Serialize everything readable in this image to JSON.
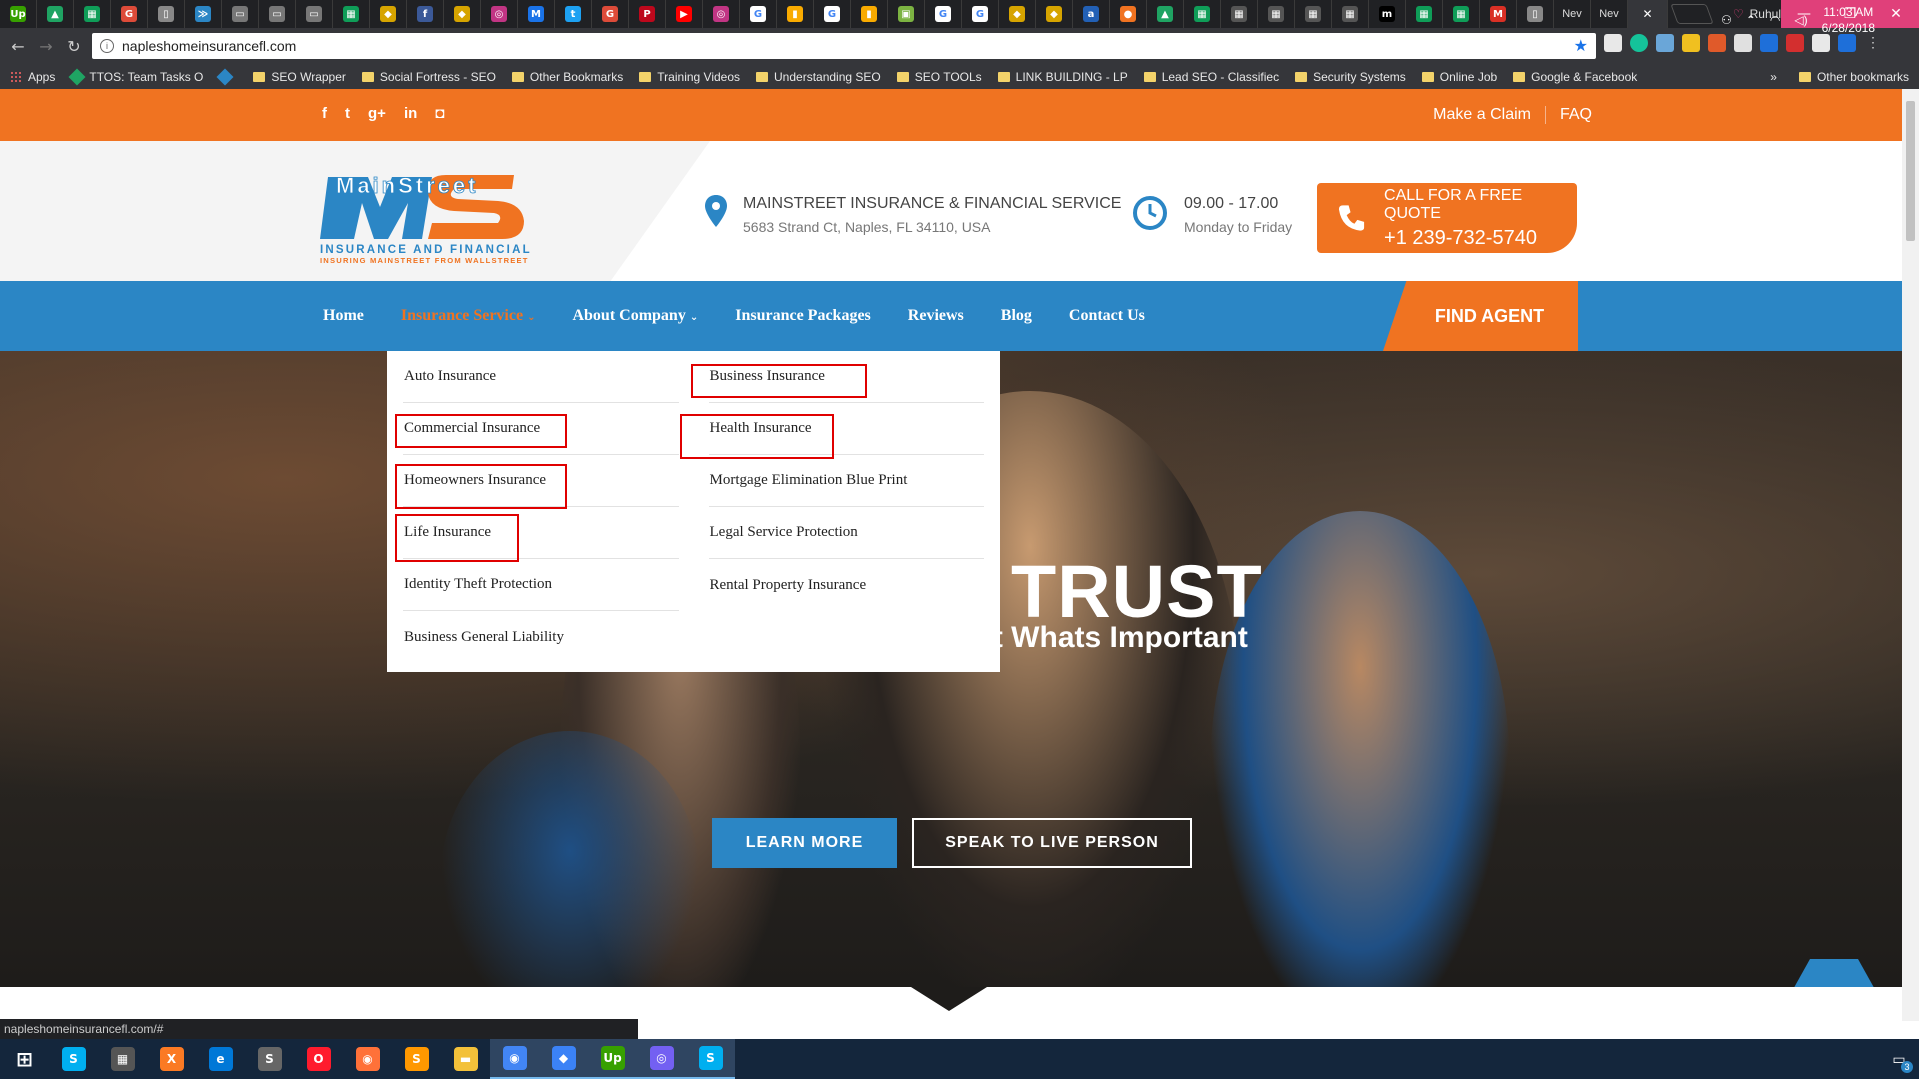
{
  "browser": {
    "tabs": [
      {
        "icon": "upwork-icon",
        "color": "#37a000",
        "glyph": "Up"
      },
      {
        "icon": "google-drive-icon",
        "color": "#1fa463",
        "glyph": "▲"
      },
      {
        "icon": "google-sheets-icon",
        "color": "#0f9d58",
        "glyph": "▦"
      },
      {
        "icon": "google-plus-icon",
        "color": "#dd4b39",
        "glyph": "G"
      },
      {
        "icon": "document-icon",
        "color": "#888888",
        "glyph": "▯"
      },
      {
        "icon": "hostgator-icon",
        "color": "#2b86c5",
        "glyph": "≫"
      },
      {
        "icon": "car-icon",
        "color": "#777777",
        "glyph": "▭"
      },
      {
        "icon": "car-icon",
        "color": "#777777",
        "glyph": "▭"
      },
      {
        "icon": "car-icon",
        "color": "#777777",
        "glyph": "▭"
      },
      {
        "icon": "google-sheets-icon",
        "color": "#0f9d58",
        "glyph": "▦"
      },
      {
        "icon": "shield-icon",
        "color": "#d6a400",
        "glyph": "◆"
      },
      {
        "icon": "facebook-icon",
        "color": "#3b5998",
        "glyph": "f"
      },
      {
        "icon": "shield-icon",
        "color": "#d6a400",
        "glyph": "◆"
      },
      {
        "icon": "instagram-icon",
        "color": "#c13584",
        "glyph": "◎"
      },
      {
        "icon": "gmail-icon",
        "color": "#1a73e8",
        "glyph": "M"
      },
      {
        "icon": "twitter-icon",
        "color": "#1da1f2",
        "glyph": "t"
      },
      {
        "icon": "google-plus-icon",
        "color": "#dd4b39",
        "glyph": "G"
      },
      {
        "icon": "pinterest-icon",
        "color": "#bd081c",
        "glyph": "P"
      },
      {
        "icon": "youtube-icon",
        "color": "#ff0000",
        "glyph": "▶"
      },
      {
        "icon": "instagram-icon",
        "color": "#c13584",
        "glyph": "◎"
      },
      {
        "icon": "google-icon",
        "color": "#ffffff",
        "glyph": "G"
      },
      {
        "icon": "analytics-icon",
        "color": "#f9ab00",
        "glyph": "▮"
      },
      {
        "icon": "google-icon",
        "color": "#ffffff",
        "glyph": "G"
      },
      {
        "icon": "analytics-icon",
        "color": "#f9ab00",
        "glyph": "▮"
      },
      {
        "icon": "seo-tool-icon",
        "color": "#7cb342",
        "glyph": "▣"
      },
      {
        "icon": "google-icon",
        "color": "#ffffff",
        "glyph": "G"
      },
      {
        "icon": "google-icon",
        "color": "#ffffff",
        "glyph": "G"
      },
      {
        "icon": "shield-icon",
        "color": "#d6a400",
        "glyph": "◆"
      },
      {
        "icon": "shield-icon",
        "color": "#d6a400",
        "glyph": "◆"
      },
      {
        "icon": "ahrefs-icon",
        "color": "#2260b5",
        "glyph": "a"
      },
      {
        "icon": "circle-icon",
        "color": "#f07321",
        "glyph": "●"
      },
      {
        "icon": "google-drive-icon",
        "color": "#1fa463",
        "glyph": "▲"
      },
      {
        "icon": "google-sheets-icon",
        "color": "#0f9d58",
        "glyph": "▦"
      },
      {
        "icon": "grid-icon",
        "color": "#555555",
        "glyph": "▦"
      },
      {
        "icon": "grid-icon",
        "color": "#555555",
        "glyph": "▦"
      },
      {
        "icon": "grid-icon",
        "color": "#555555",
        "glyph": "▦"
      },
      {
        "icon": "grid-icon",
        "color": "#555555",
        "glyph": "▦"
      },
      {
        "icon": "medium-icon",
        "color": "#000000",
        "glyph": "m"
      },
      {
        "icon": "google-sheets-icon",
        "color": "#0f9d58",
        "glyph": "▦"
      },
      {
        "icon": "google-sheets-icon",
        "color": "#0f9d58",
        "glyph": "▦"
      },
      {
        "icon": "gmail-icon",
        "color": "#d93025",
        "glyph": "M"
      },
      {
        "icon": "document-icon",
        "color": "#888888",
        "glyph": "▯"
      }
    ],
    "text_tabs": [
      "Nev",
      "Nev"
    ],
    "profile_name": "Ruhul",
    "url": "napleshomeinsurancefl.com",
    "bookmarks": [
      {
        "label": "Apps",
        "icon": "apps-icon"
      },
      {
        "label": "TTOS: Team Tasks O",
        "icon": "google-drive-icon"
      },
      {
        "label": "",
        "icon": "hostgator-icon"
      },
      {
        "label": "SEO Wrapper",
        "icon": "folder-icon"
      },
      {
        "label": "Social Fortress - SEO",
        "icon": "folder-icon"
      },
      {
        "label": "Other Bookmarks",
        "icon": "folder-icon"
      },
      {
        "label": "Training Videos",
        "icon": "folder-icon"
      },
      {
        "label": "Understanding SEO",
        "icon": "folder-icon"
      },
      {
        "label": "SEO TOOLs",
        "icon": "folder-icon"
      },
      {
        "label": "LINK BUILDING - LP",
        "icon": "folder-icon"
      },
      {
        "label": "Lead SEO - Classifiec",
        "icon": "folder-icon"
      },
      {
        "label": "Security Systems",
        "icon": "folder-icon"
      },
      {
        "label": "Online Job",
        "icon": "folder-icon"
      },
      {
        "label": "Google & Facebook",
        "icon": "folder-icon"
      }
    ],
    "bookmarks_overflow": "»",
    "other_bookmarks": "Other bookmarks",
    "status_url": "napleshomeinsurancefl.com/#"
  },
  "site": {
    "topbar": {
      "links": [
        "Make a Claim",
        "FAQ"
      ]
    },
    "logo": {
      "text_top": "MainStreet",
      "text_line1": "INSURANCE AND FINANCIAL",
      "text_line2": "INSURING MAINSTREET FROM WALLSTREET"
    },
    "contact": {
      "company": "MAINSTREET INSURANCE & FINANCIAL SERVICE",
      "address": "5683 Strand Ct, Naples, FL 34110, USA",
      "hours": "09.00 - 17.00",
      "days": "Monday to Friday"
    },
    "quote": {
      "title": "CALL FOR A FREE QUOTE",
      "phone": "+1 239-732-5740"
    },
    "nav": {
      "items": [
        "Home",
        "Insurance Service",
        "About Company",
        "Insurance Packages",
        "Reviews",
        "Blog",
        "Contact Us"
      ],
      "find_agent": "FIND AGENT"
    },
    "dropdown": {
      "col1": [
        "Auto Insurance",
        "Commercial Insurance",
        "Homeowners Insurance",
        "Life Insurance",
        "Identity Theft Protection",
        "Business General Liability"
      ],
      "col2": [
        "Business Insurance",
        "Health Insurance",
        "Mortgage Elimination Blue Print",
        "Legal Service Protection",
        "Rental Property Insurance"
      ]
    },
    "hero": {
      "title": "OUR TRUST",
      "subtitle": "To Secure the Future, Protect Whats Important",
      "learn_more": "LEARN MORE",
      "speak": "SPEAK TO LIVE PERSON"
    }
  },
  "taskbar": {
    "apps": [
      {
        "icon": "windows-start-icon",
        "color": "#ffffff",
        "glyph": "⊞"
      },
      {
        "icon": "skype-icon",
        "color": "#00aff0",
        "glyph": "S"
      },
      {
        "icon": "calculator-icon",
        "color": "#555555",
        "glyph": "▦"
      },
      {
        "icon": "xampp-icon",
        "color": "#fb7a24",
        "glyph": "X"
      },
      {
        "icon": "edge-icon",
        "color": "#0078d7",
        "glyph": "e"
      },
      {
        "icon": "store-icon",
        "color": "#666666",
        "glyph": "S"
      },
      {
        "icon": "opera-icon",
        "color": "#ff1b2d",
        "glyph": "O"
      },
      {
        "icon": "firefox-icon",
        "color": "#ff7139",
        "glyph": "◉"
      },
      {
        "icon": "sublime-icon",
        "color": "#ff9800",
        "glyph": "S"
      },
      {
        "icon": "file-explorer-icon",
        "color": "#f3c13a",
        "glyph": "▬"
      },
      {
        "icon": "chrome-icon",
        "color": "#4285f4",
        "glyph": "◉"
      },
      {
        "icon": "shield-icon",
        "color": "#3b82f6",
        "glyph": "◆"
      },
      {
        "icon": "upwork-icon",
        "color": "#37a000",
        "glyph": "Up"
      },
      {
        "icon": "viber-icon",
        "color": "#7360f2",
        "glyph": "◎"
      },
      {
        "icon": "skype-icon",
        "color": "#00aff0",
        "glyph": "S"
      }
    ],
    "time": "11:03 AM",
    "date": "6/28/2018",
    "notification_count": "3"
  },
  "colors": {
    "brand_orange": "#f07321",
    "brand_blue": "#2b86c5",
    "highlight_red": "#e00000"
  }
}
